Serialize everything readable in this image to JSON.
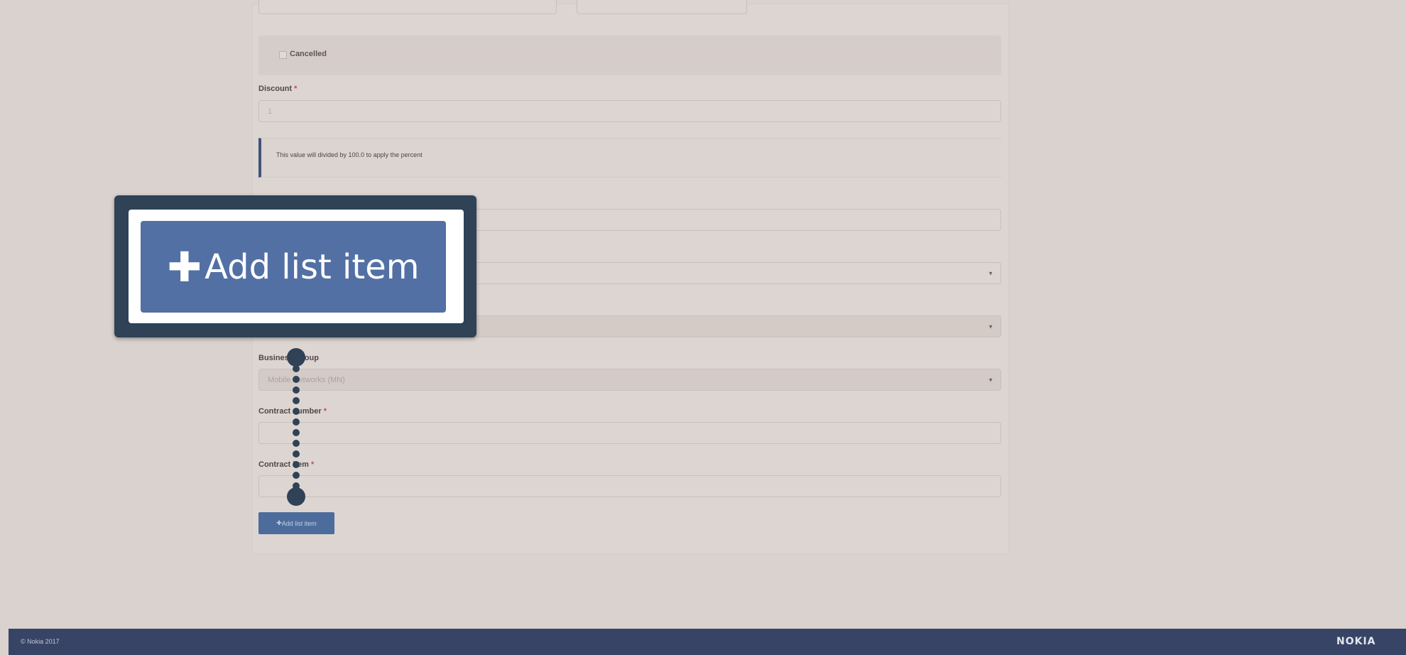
{
  "form": {
    "cancelled_label": "Cancelled",
    "discount_label": "Discount",
    "required_mark": "*",
    "discount_value": "1",
    "info_text": "This value will divided by 100.0 to apply the percent",
    "business_group_label": "Business Group",
    "business_group_value": "Mobile Networks (MN)",
    "contract_number_label": "Contract number",
    "contract_item_label": "Contract item",
    "add_item_button": "Add list item"
  },
  "callout": {
    "label": "Add list item",
    "icon": "plus-icon"
  },
  "footer": {
    "copyright": "© Nokia 2017",
    "logo": "NOKIA"
  },
  "colors": {
    "accent": "#5270a4",
    "footer_bg": "#374466",
    "callout_frame": "#2f4256"
  }
}
